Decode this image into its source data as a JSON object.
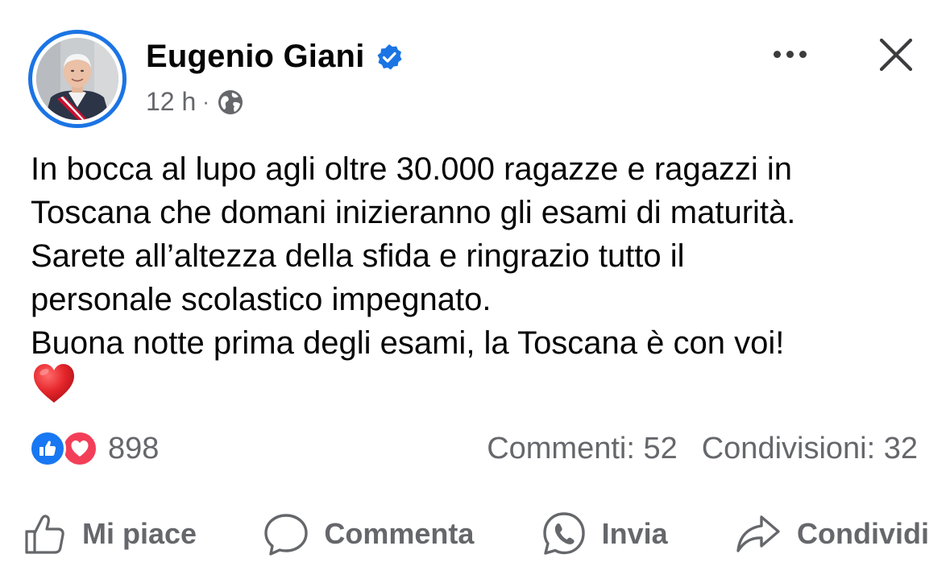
{
  "author": {
    "name": "Eugenio Giani",
    "verified": true,
    "time": "12 h",
    "separator": "·",
    "audience_icon": "globe-icon"
  },
  "post": {
    "text": "In bocca al lupo agli oltre 30.000 ragazze e ragazzi in\nToscana che domani inizieranno gli esami di maturità.\nSarete all’altezza della sfida e ringrazio tutto il\npersonale scolastico impegnato.\nBuona notte prima degli esami, la Toscana è con voi!",
    "emoji": "red-heart-emoji"
  },
  "reactions": {
    "icons": [
      "like-reaction-icon",
      "love-reaction-icon"
    ],
    "count": "898"
  },
  "stats": {
    "comments": "Commenti: 52",
    "shares": "Condivisioni: 32"
  },
  "actions": {
    "like": "Mi piace",
    "comment": "Commenta",
    "send": "Invia",
    "share": "Condividi"
  },
  "colors": {
    "accent": "#1b74e4",
    "secondary_text": "#65676b",
    "like": "#1877f2",
    "love": "#f33e58"
  }
}
